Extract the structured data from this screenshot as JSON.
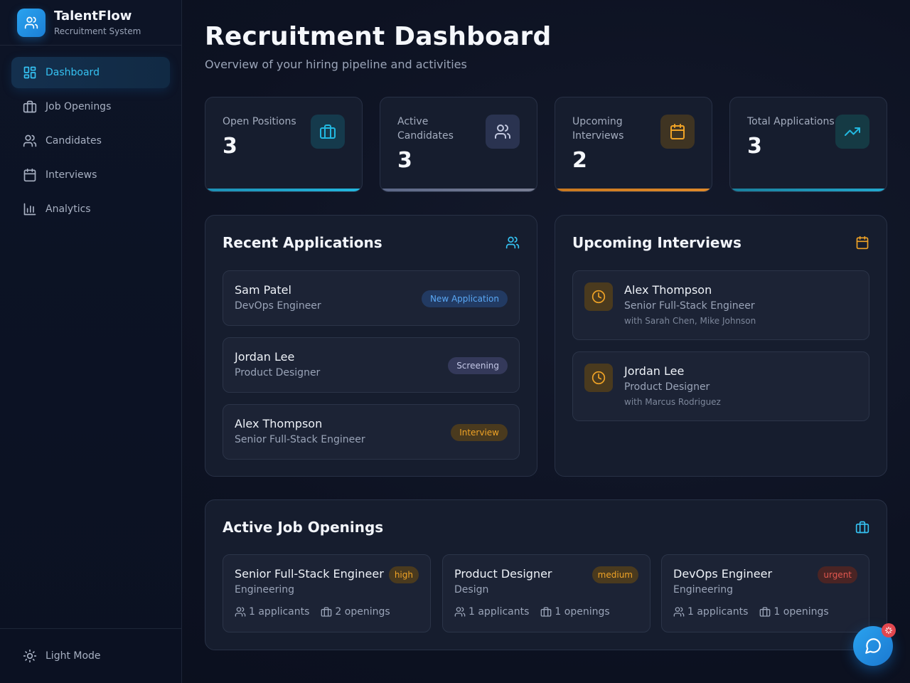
{
  "brand": {
    "name": "TalentFlow",
    "subtitle": "Recruitment System"
  },
  "nav": [
    {
      "label": "Dashboard",
      "icon": "dashboard-icon",
      "active": true
    },
    {
      "label": "Job Openings",
      "icon": "briefcase-icon"
    },
    {
      "label": "Candidates",
      "icon": "users-icon"
    },
    {
      "label": "Interviews",
      "icon": "calendar-icon"
    },
    {
      "label": "Analytics",
      "icon": "bar-chart-icon"
    }
  ],
  "footer": {
    "theme_toggle": "Light Mode"
  },
  "header": {
    "title": "Recruitment Dashboard",
    "subtitle": "Overview of your hiring pipeline and activities"
  },
  "stats": [
    {
      "label": "Open Positions",
      "value": "3",
      "icon": "briefcase-icon",
      "color": "#22b8e0"
    },
    {
      "label": "Active Candidates",
      "value": "3",
      "icon": "users-icon",
      "color": "#9aa4c8"
    },
    {
      "label": "Upcoming Interviews",
      "value": "2",
      "icon": "calendar-icon",
      "color": "#f0a326"
    },
    {
      "label": "Total Applications",
      "value": "3",
      "icon": "trending-up-icon",
      "color": "#22b8e0"
    }
  ],
  "recent_applications": {
    "title": "Recent Applications",
    "items": [
      {
        "name": "Sam Patel",
        "role": "DevOps Engineer",
        "status": "New Application"
      },
      {
        "name": "Jordan Lee",
        "role": "Product Designer",
        "status": "Screening"
      },
      {
        "name": "Alex Thompson",
        "role": "Senior Full-Stack Engineer",
        "status": "Interview"
      }
    ]
  },
  "upcoming_interviews": {
    "title": "Upcoming Interviews",
    "items": [
      {
        "name": "Alex Thompson",
        "role": "Senior Full-Stack Engineer",
        "with": "with Sarah Chen, Mike Johnson"
      },
      {
        "name": "Jordan Lee",
        "role": "Product Designer",
        "with": "with Marcus Rodriguez"
      }
    ]
  },
  "job_openings": {
    "title": "Active Job Openings",
    "items": [
      {
        "title": "Senior Full-Stack Engineer",
        "department": "Engineering",
        "priority": "high",
        "applicants": "1 applicants",
        "openings": "2 openings"
      },
      {
        "title": "Product Designer",
        "department": "Design",
        "priority": "medium",
        "applicants": "1 applicants",
        "openings": "1 openings"
      },
      {
        "title": "DevOps Engineer",
        "department": "Engineering",
        "priority": "urgent",
        "applicants": "1 applicants",
        "openings": "1 openings"
      }
    ]
  },
  "colors": {
    "accent": "#35c2f2",
    "brand_gradient_start": "#2aa3ef",
    "status_new": "#5aa8f5",
    "status_screening": "#c3c7e6",
    "status_interview": "#f0a326",
    "priority_high": "#f0a326",
    "priority_medium": "#f0a326",
    "priority_urgent": "#e2574f"
  }
}
